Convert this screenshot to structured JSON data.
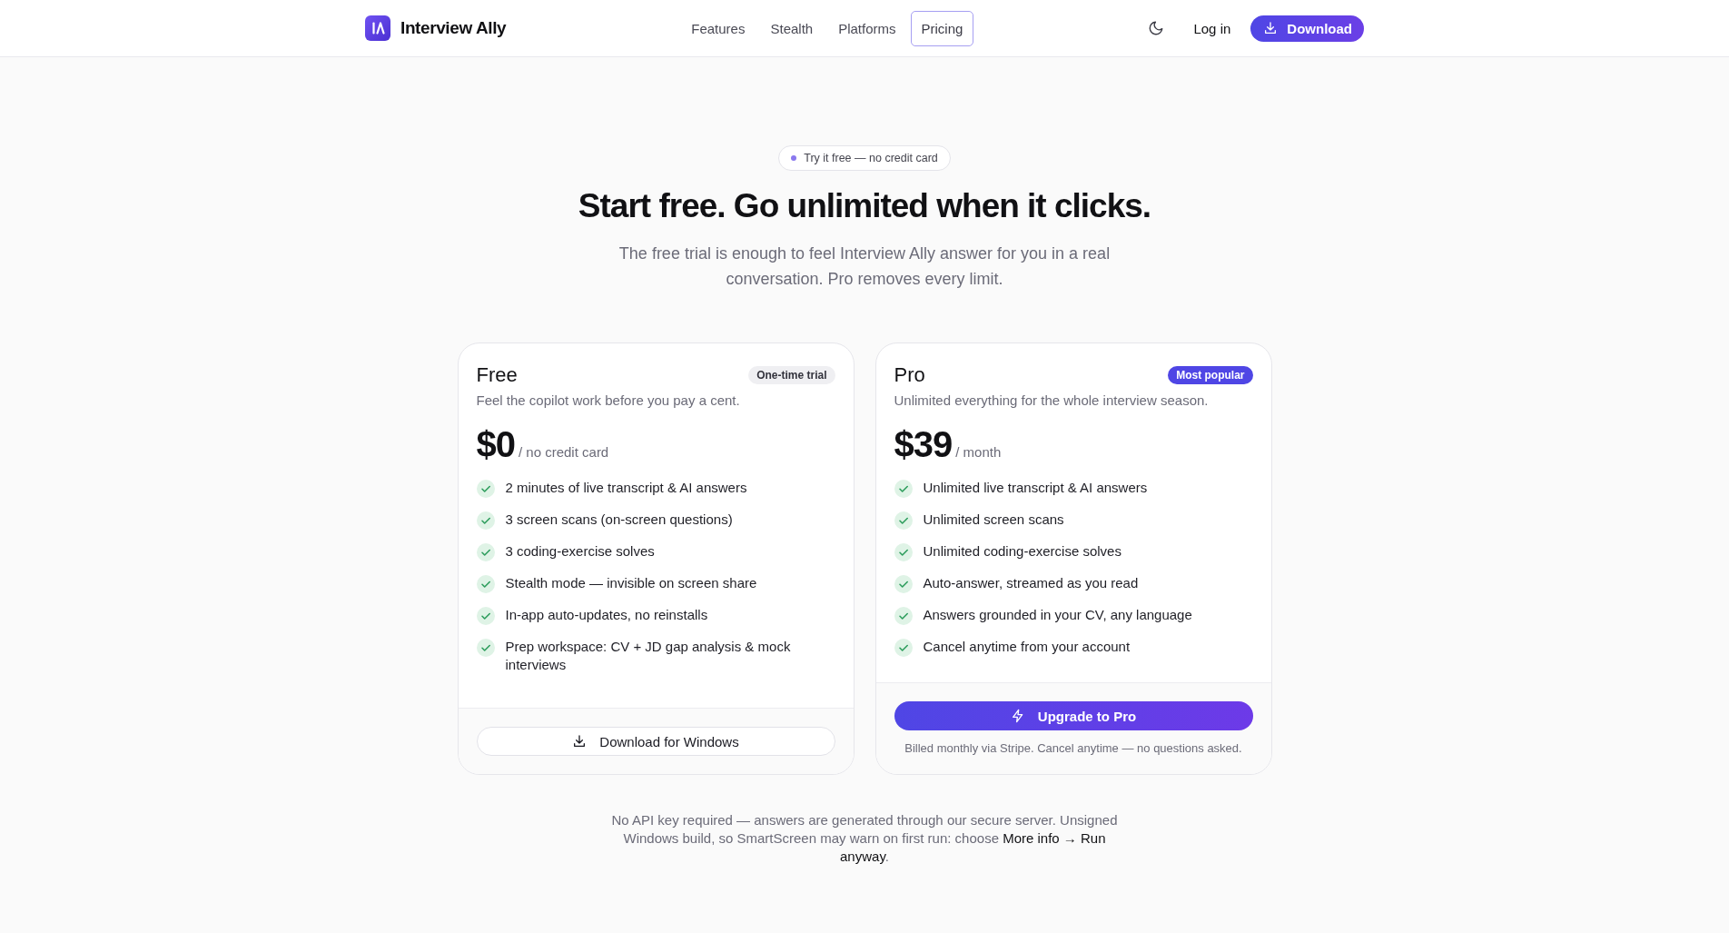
{
  "header": {
    "brand": "Interview Ally",
    "nav": [
      {
        "label": "Features",
        "selected": false
      },
      {
        "label": "Stealth",
        "selected": false
      },
      {
        "label": "Platforms",
        "selected": false
      },
      {
        "label": "Pricing",
        "selected": true
      }
    ],
    "login": "Log in",
    "download": "Download"
  },
  "hero": {
    "badge": "Try it free — no credit card",
    "title": "Start free. Go unlimited when it clicks.",
    "subtitle": "The free trial is enough to feel Interview Ally answer for you in a real conversation. Pro removes every limit."
  },
  "plans": [
    {
      "kind": "free",
      "name": "Free",
      "tag": "One-time trial",
      "description": "Feel the copilot work before you pay a cent.",
      "price": "$0",
      "period": "/ no credit card",
      "features": [
        "2 minutes of live transcript & AI answers",
        "3 screen scans (on-screen questions)",
        "3 coding-exercise solves",
        "Stealth mode — invisible on screen share",
        "In-app auto-updates, no reinstalls",
        "Prep workspace: CV + JD gap analysis & mock interviews"
      ],
      "cta": "Download for Windows"
    },
    {
      "kind": "pro",
      "name": "Pro",
      "tag": "Most popular",
      "description": "Unlimited everything for the whole interview season.",
      "price": "$39",
      "period": "/ month",
      "features": [
        "Unlimited live transcript & AI answers",
        "Unlimited screen scans",
        "Unlimited coding-exercise solves",
        "Auto-answer, streamed as you read",
        "Answers grounded in your CV, any language",
        "Cancel anytime from your account"
      ],
      "cta": "Upgrade to Pro",
      "note": "Billed monthly via Stripe. Cancel anytime — no questions asked."
    }
  ],
  "footnote": "No API key required — answers are generated through our secure server. Unsigned Windows build, so SmartScreen may warn on first run: choose **More info → Run anyway**."
}
